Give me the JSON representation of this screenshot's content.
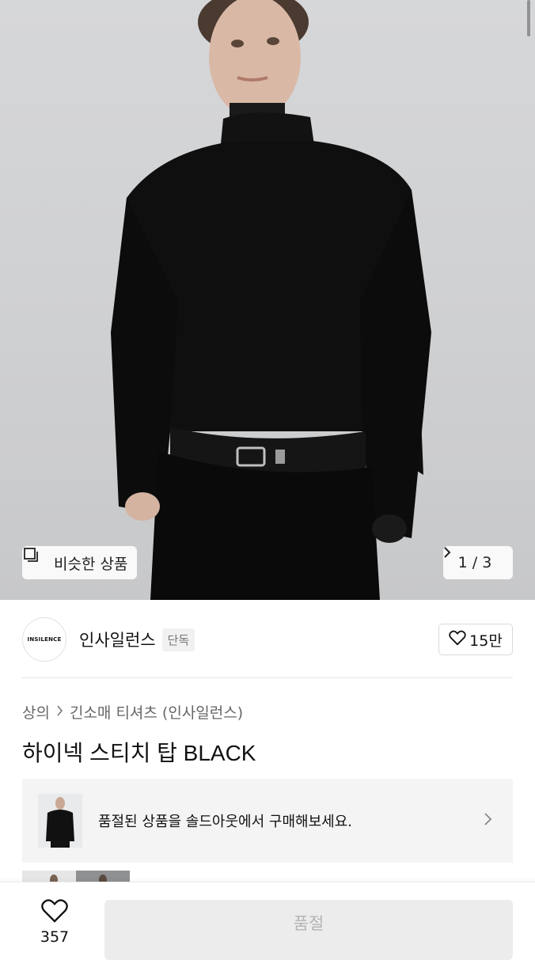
{
  "hero": {
    "image_alt": "model-wearing-black-turtleneck",
    "similar_label": "비슷한 상품",
    "counter": "1 / 3"
  },
  "brand": {
    "logo_text": "INSILENCE",
    "name": "인사일런스",
    "badge": "단독",
    "likes": "15만"
  },
  "breadcrumb": {
    "category": "상의",
    "subcategory": "긴소매 티셔츠 (인사일런스)"
  },
  "product": {
    "title": "하이넥 스티치 탑 BLACK"
  },
  "soldout_banner": {
    "text": "품절된 상품을 솔드아웃에서 구매해보세요."
  },
  "bottom_bar": {
    "wish_count": "357",
    "buy_label": "품절"
  },
  "colors": {
    "accent_disabled": "#ececec",
    "text_primary": "#111111"
  }
}
